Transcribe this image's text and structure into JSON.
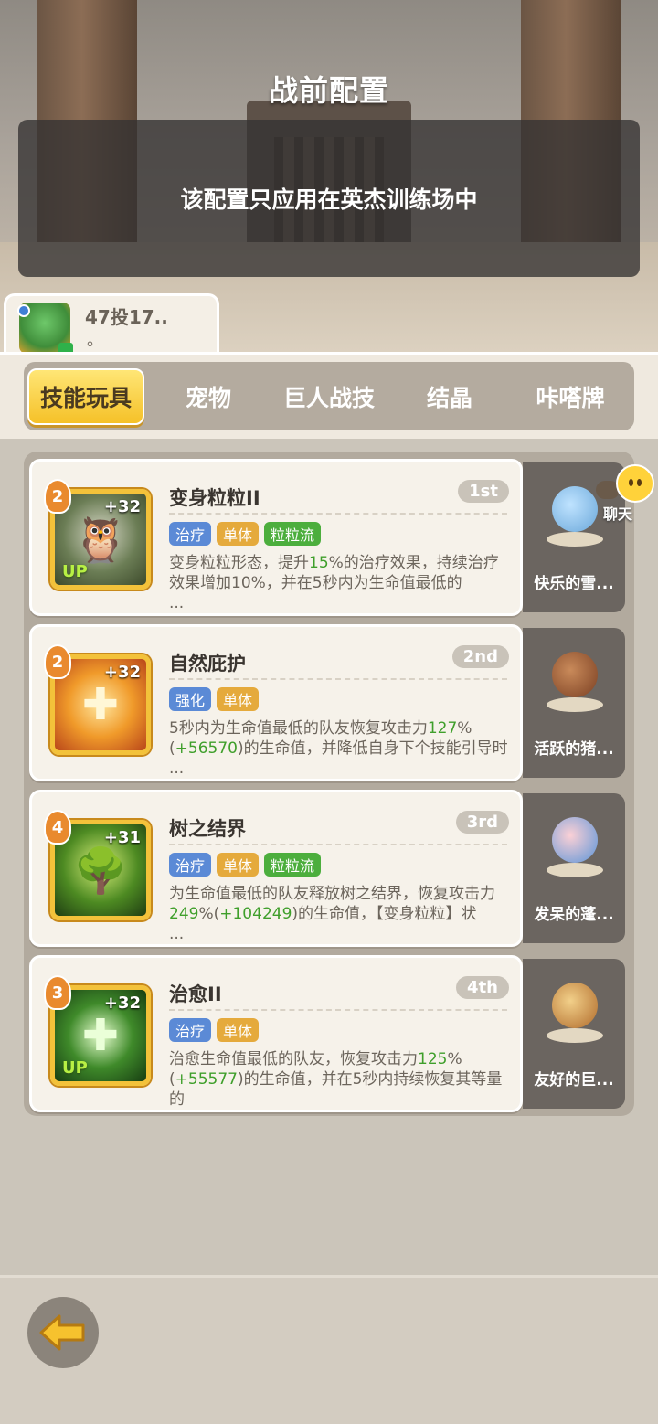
{
  "header": {
    "title": "战前配置",
    "notice": "该配置只应用在英杰训练场中"
  },
  "player": {
    "name": "47投17..",
    "sub": "。"
  },
  "tabs": [
    {
      "label": "技能玩具",
      "active": true
    },
    {
      "label": "宠物",
      "active": false
    },
    {
      "label": "巨人战技",
      "active": false
    },
    {
      "label": "结晶",
      "active": false
    },
    {
      "label": "咔嗒牌",
      "active": false
    }
  ],
  "skills": [
    {
      "name": "变身粒粒II",
      "rank": "1st",
      "level": "2",
      "bonus": "+32",
      "upgrade": "UP",
      "icon": "owl-icon",
      "tags": [
        {
          "label": "治疗",
          "color": "blue"
        },
        {
          "label": "单体",
          "color": "orange"
        },
        {
          "label": "粒粒流",
          "color": "green"
        }
      ],
      "desc": {
        "a": "变身粒粒形态，提升",
        "b": "15",
        "c": "%的治疗效果，持续治疗效果增加10%，并在5秒内为生命值最低的",
        "d": "",
        "e": "",
        "more": "..."
      },
      "pet": {
        "name": "快乐的雪..."
      }
    },
    {
      "name": "自然庇护",
      "rank": "2nd",
      "level": "2",
      "bonus": "+32",
      "upgrade": "",
      "icon": "cross-icon",
      "tags": [
        {
          "label": "强化",
          "color": "blue"
        },
        {
          "label": "单体",
          "color": "orange"
        }
      ],
      "desc": {
        "a": "5秒内为生命值最低的队友恢复攻击力",
        "b": "127",
        "c": "%(",
        "d": "+56570",
        "e": ")的生命值，并降低自身下个技能引导时",
        "more": "..."
      },
      "pet": {
        "name": "活跃的猪..."
      }
    },
    {
      "name": "树之结界",
      "rank": "3rd",
      "level": "4",
      "bonus": "+31",
      "upgrade": "",
      "icon": "tree-icon",
      "tags": [
        {
          "label": "治疗",
          "color": "blue"
        },
        {
          "label": "单体",
          "color": "orange"
        },
        {
          "label": "粒粒流",
          "color": "green"
        }
      ],
      "desc": {
        "a": "为生命值最低的队友释放树之结界，恢复攻击力",
        "b": "249",
        "c": "%(",
        "d": "+104249",
        "e": ")的生命值，【变身粒粒】状",
        "more": "..."
      },
      "pet": {
        "name": "发呆的蓬..."
      }
    },
    {
      "name": "治愈II",
      "rank": "4th",
      "level": "3",
      "bonus": "+32",
      "upgrade": "UP",
      "icon": "heal-cross-icon",
      "tags": [
        {
          "label": "治疗",
          "color": "blue"
        },
        {
          "label": "单体",
          "color": "orange"
        }
      ],
      "desc": {
        "a": "治愈生命值最低的队友，恢复攻击力",
        "b": "125",
        "c": "%(",
        "d": "+55577",
        "e": ")的生命值，并在5秒内持续恢复其等量的",
        "more": "..."
      },
      "pet": {
        "name": "友好的巨..."
      }
    }
  ],
  "chat": {
    "label": "聊天"
  },
  "colors": {
    "tag_blue": "#5b8ad6",
    "tag_orange": "#e5aa3c",
    "tag_green": "#4cae3d",
    "highlight": "#3f9f2b",
    "active_tab": "#f5c128"
  }
}
